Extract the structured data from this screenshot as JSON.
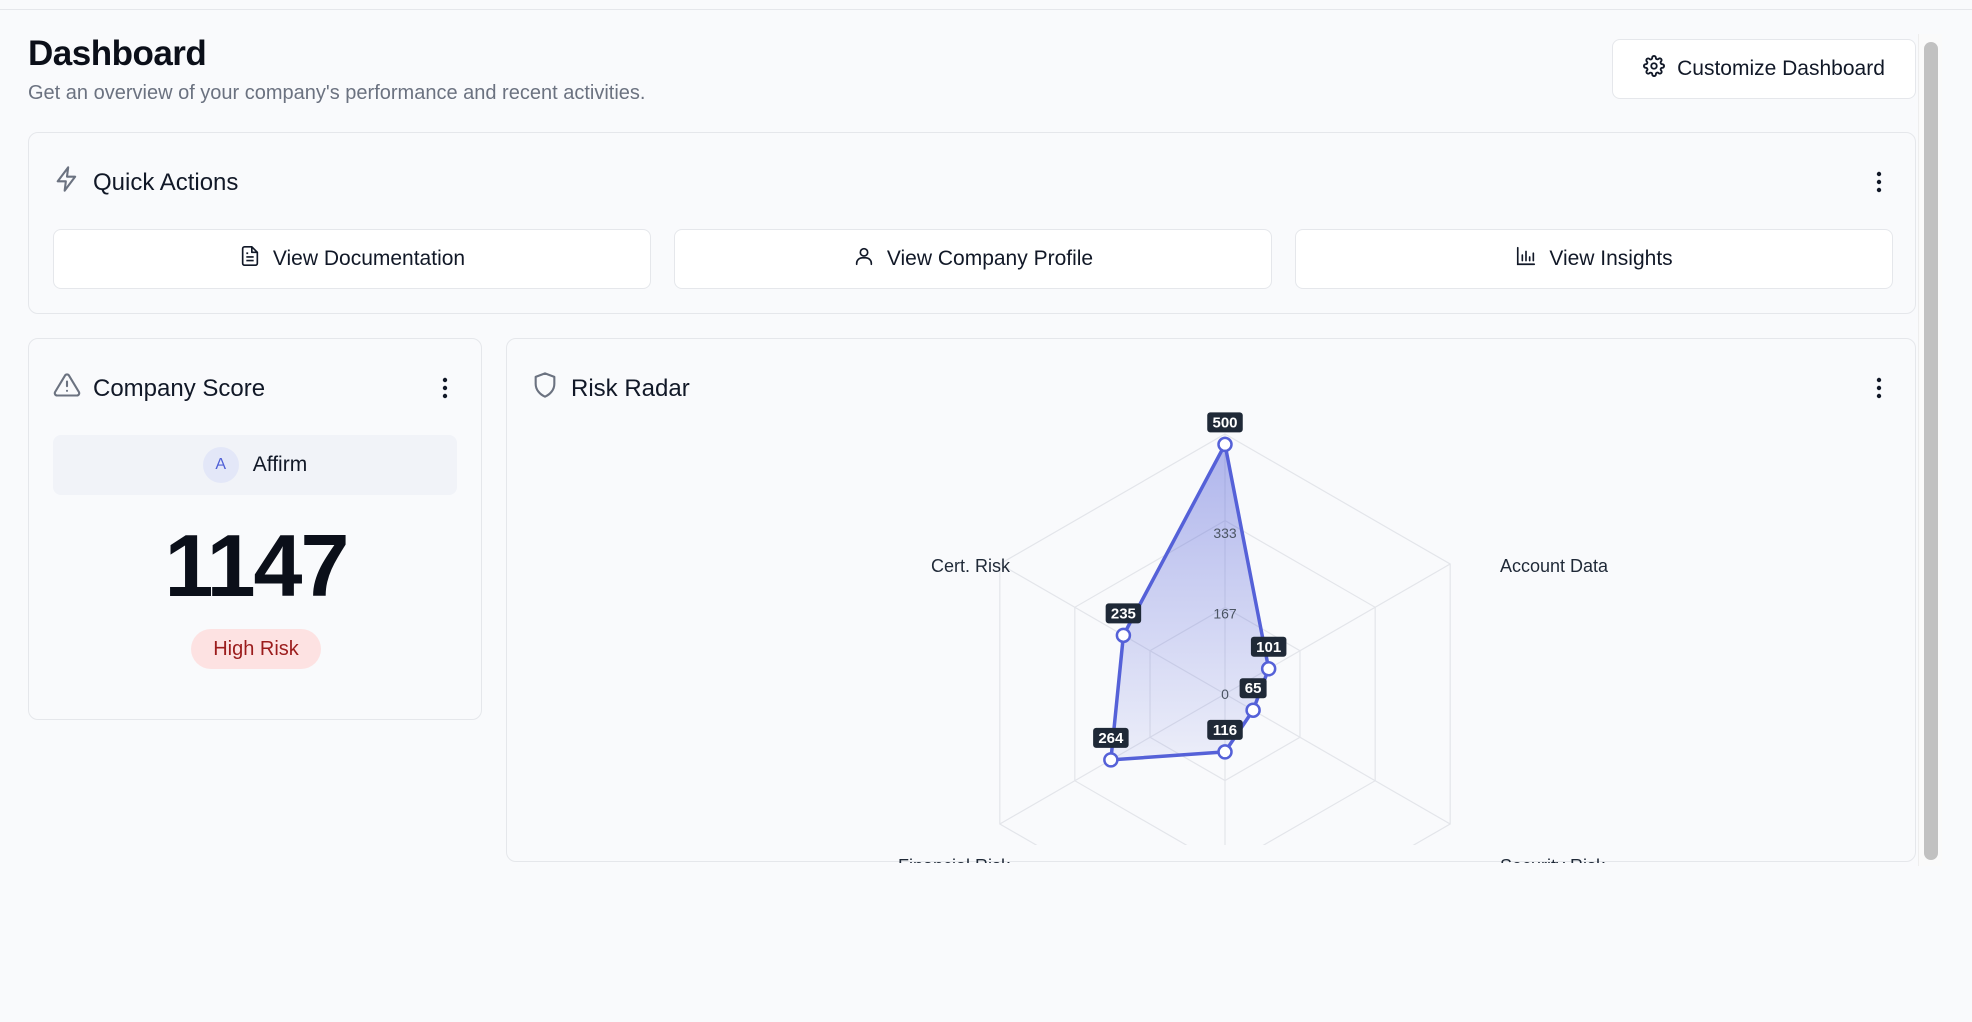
{
  "header": {
    "title": "Dashboard",
    "subtitle": "Get an overview of your company's performance and recent activities.",
    "customize_label": "Customize Dashboard"
  },
  "quick_actions": {
    "title": "Quick Actions",
    "buttons": [
      {
        "label": "View Documentation",
        "icon": "document-icon"
      },
      {
        "label": "View Company Profile",
        "icon": "user-icon"
      },
      {
        "label": "View Insights",
        "icon": "bar-chart-icon"
      }
    ]
  },
  "company_score": {
    "title": "Company Score",
    "company_initial": "A",
    "company_name": "Affirm",
    "score": "1147",
    "risk_label": "High Risk"
  },
  "risk_radar": {
    "title": "Risk Radar"
  },
  "colors": {
    "accent": "#5561d8",
    "risk_bg": "#fde2e2",
    "risk_text": "#9b1c1c"
  },
  "chart_data": {
    "type": "radar",
    "categories": [
      "Cert. Risk",
      "Account Data",
      "Security Risk",
      "Financial Risk"
    ],
    "axes_order": [
      "top",
      "Account Data",
      "Security Risk",
      "bottom",
      "Financial Risk",
      "Cert. Risk"
    ],
    "values": [
      500,
      101,
      65,
      116,
      264,
      235
    ],
    "ring_ticks": [
      "0",
      "167",
      "333"
    ],
    "range": [
      0,
      500
    ],
    "grid": true,
    "legend": "none"
  }
}
